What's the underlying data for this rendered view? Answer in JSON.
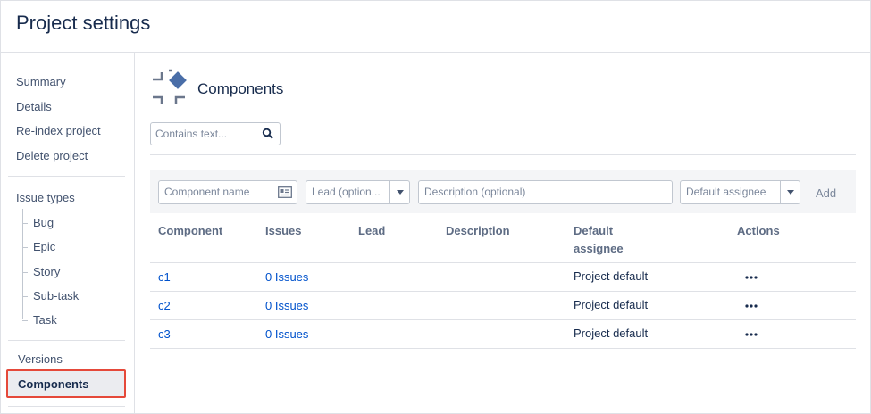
{
  "header": {
    "title": "Project settings"
  },
  "sidebar": {
    "top_items": [
      "Summary",
      "Details",
      "Re-index project",
      "Delete project"
    ],
    "issue_types_label": "Issue types",
    "issue_types": [
      "Bug",
      "Epic",
      "Story",
      "Sub-task",
      "Task"
    ],
    "versions_label": "Versions",
    "components_label": "Components"
  },
  "main": {
    "icon": "components-icon",
    "title": "Components",
    "search": {
      "placeholder": "Contains text...",
      "icon": "search-icon"
    },
    "add_form": {
      "component_name_placeholder": "Component name",
      "lead_placeholder": "Lead (option...",
      "description_placeholder": "Description (optional)",
      "assignee_placeholder": "Default assignee",
      "add_label": "Add"
    },
    "table": {
      "headers": {
        "component": "Component",
        "issues": "Issues",
        "lead": "Lead",
        "description": "Description",
        "default_assignee_1": "Default",
        "default_assignee_2": "assignee",
        "actions": "Actions"
      },
      "rows": [
        {
          "component": "c1",
          "issues": "0 Issues",
          "lead": "",
          "description": "",
          "assignee": "Project default",
          "actions": "more-icon"
        },
        {
          "component": "c2",
          "issues": "0 Issues",
          "lead": "",
          "description": "",
          "assignee": "Project default",
          "actions": "more-icon"
        },
        {
          "component": "c3",
          "issues": "0 Issues",
          "lead": "",
          "description": "",
          "assignee": "Project default",
          "actions": "more-icon"
        }
      ]
    }
  },
  "colors": {
    "link": "#0052cc",
    "text": "#172b4d",
    "highlight_border": "#e5493a",
    "icon_blue": "#4a6ea8"
  }
}
